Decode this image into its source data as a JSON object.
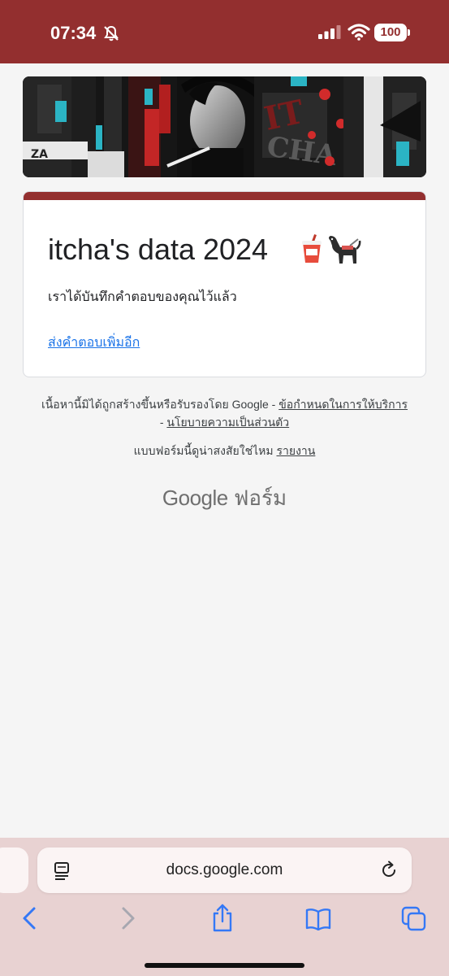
{
  "status_bar": {
    "time": "07:34",
    "battery": "100",
    "icons": [
      "bell-slash-icon",
      "signal-icon",
      "wifi-icon",
      "battery-icon"
    ]
  },
  "form": {
    "title": "itcha's data 2024",
    "title_emoji": [
      "cup-with-straw-icon",
      "service-dog-icon"
    ],
    "confirmation": "เราได้บันทึกคำตอบของคุณไว้แล้ว",
    "resubmit_link": "ส่งคำตอบเพิ่มอีก"
  },
  "footer": {
    "disclaimer_text": "เนื้อหานี้มิได้ถูกสร้างขึ้นหรือรับรองโดย Google - ",
    "terms_link": "ข้อกำหนดในการให้บริการ",
    "separator": " - ",
    "privacy_link": "นโยบายความเป็นส่วนตัว",
    "report_text": "แบบฟอร์มนี้ดูน่าสงสัยใช่ไหม ",
    "report_link": "รายงาน",
    "brand_google": "Google",
    "brand_forms": " ฟอร์ม"
  },
  "browser": {
    "url": "docs.google.com",
    "nav_icons": [
      "back-icon",
      "forward-icon",
      "share-icon",
      "bookmarks-icon",
      "tabs-icon"
    ]
  },
  "colors": {
    "accent": "#932f2f",
    "link": "#1a73e8",
    "toolbar_bg": "#e8d2d2",
    "icon_blue": "#3478f6"
  }
}
